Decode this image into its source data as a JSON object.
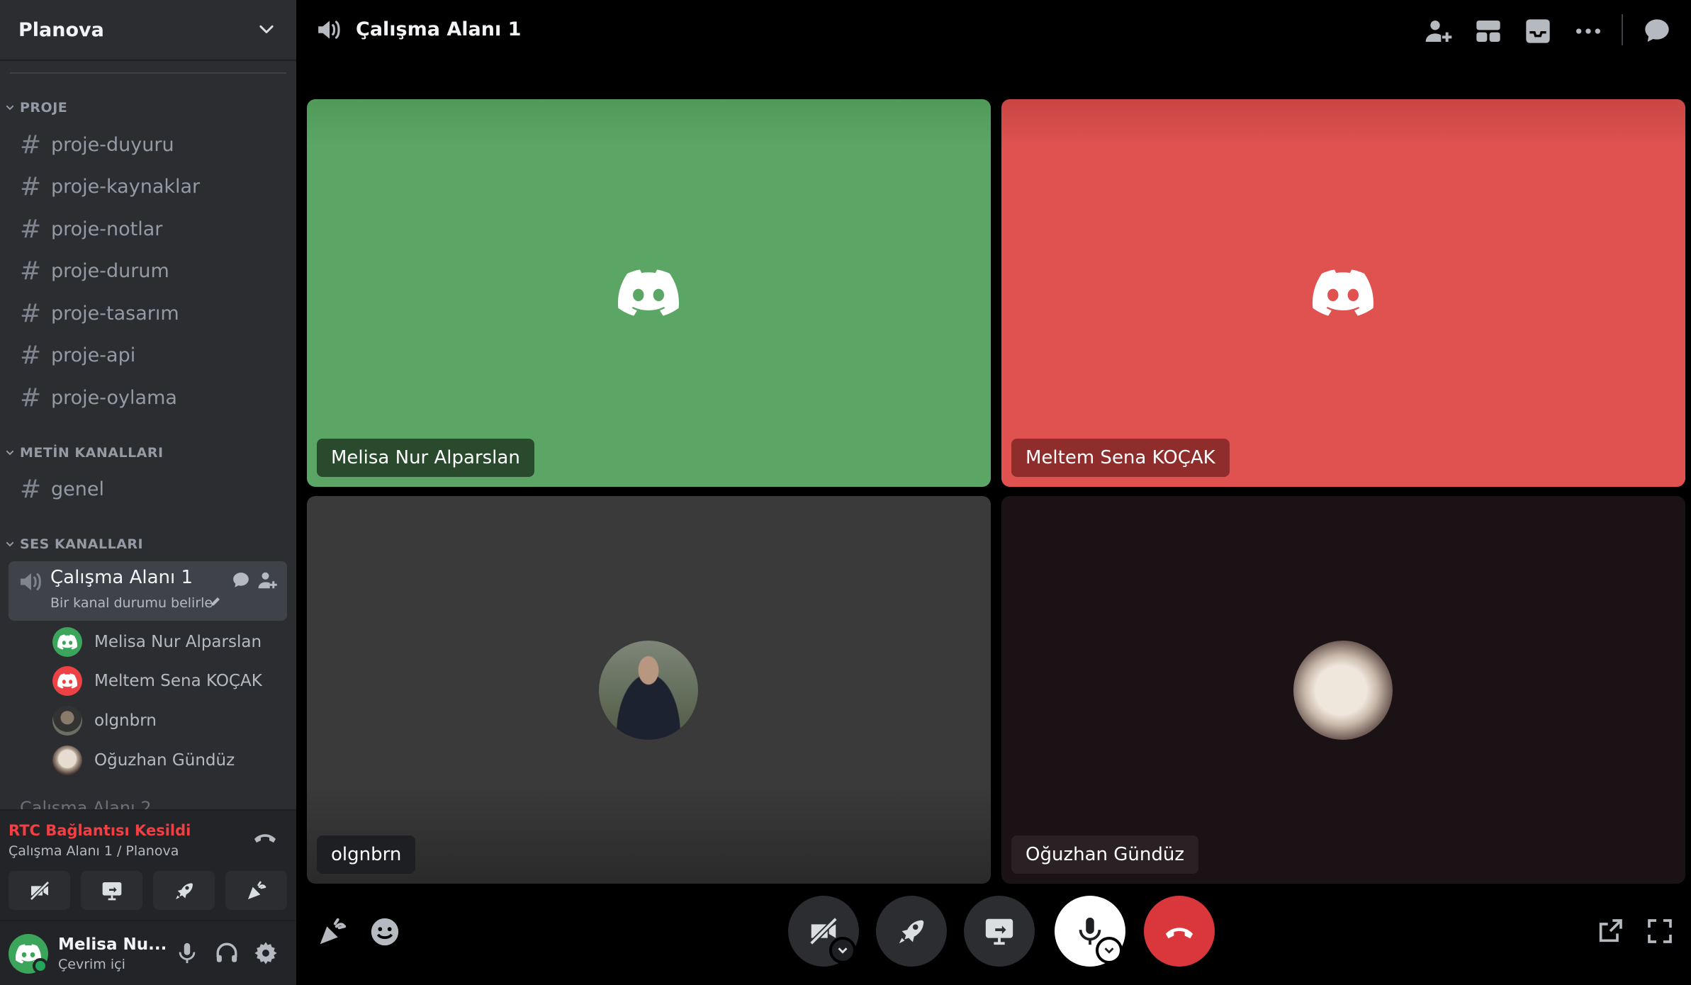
{
  "server": {
    "name": "Planova"
  },
  "categories": [
    {
      "label": "PROJE"
    },
    {
      "label": "METİN KANALLARI"
    },
    {
      "label": "SES KANALLARI"
    }
  ],
  "text_channels": [
    {
      "name": "proje-duyuru"
    },
    {
      "name": "proje-kaynaklar"
    },
    {
      "name": "proje-notlar"
    },
    {
      "name": "proje-durum"
    },
    {
      "name": "proje-tasarım"
    },
    {
      "name": "proje-api"
    },
    {
      "name": "proje-oylama"
    },
    {
      "name": "genel"
    }
  ],
  "voice_channel": {
    "name": "Çalışma Alanı 1",
    "status_placeholder": "Bir kanal durumu belirle",
    "members": [
      {
        "name": "Melisa Nur Alparslan",
        "avatar": "discord-green"
      },
      {
        "name": "Meltem Sena KOÇAK",
        "avatar": "discord-red"
      },
      {
        "name": "olgnbrn",
        "avatar": "photo-man"
      },
      {
        "name": "Oğuzhan Gündüz",
        "avatar": "photo-cat"
      }
    ],
    "next_channel_partial": "Çalışma Alanı 2"
  },
  "rtc": {
    "title": "RTC Bağlantısı Kesildi",
    "subtitle": "Çalışma Alanı 1 / Planova"
  },
  "user": {
    "name": "Melisa Nu...",
    "status": "Çevrim içi"
  },
  "header": {
    "title": "Çalışma Alanı 1"
  },
  "tiles": [
    {
      "name": "Melisa Nur Alparslan",
      "bg": "#5ba565"
    },
    {
      "name": "Meltem Sena KOÇAK",
      "bg": "#df5250"
    },
    {
      "name": "olgnbrn",
      "bg": "#3a3a3a"
    },
    {
      "name": "Oğuzhan Gündüz",
      "bg": "#1a1214"
    }
  ],
  "colors": {
    "accent_red": "#f23f43",
    "online": "#23a55a",
    "hangup": "#da373c"
  }
}
